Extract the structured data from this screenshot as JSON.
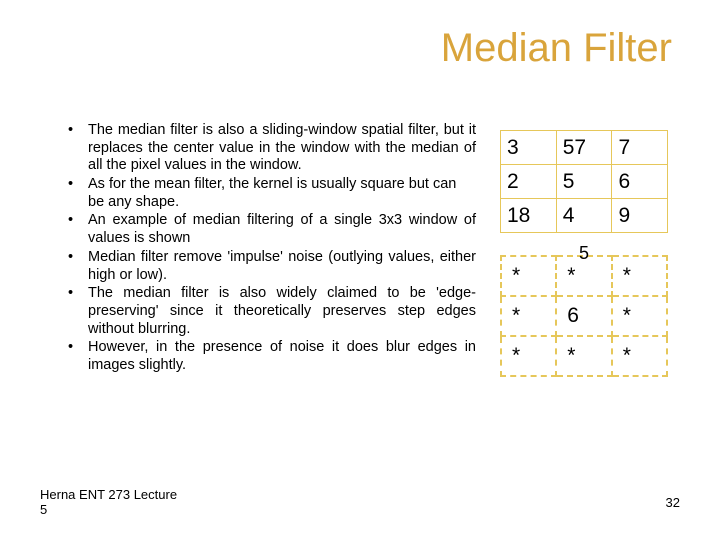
{
  "title": "Median Filter",
  "bullets": {
    "items": [
      "The median filter is also a sliding-window spatial filter, but it replaces the center value in the window with the median of all the pixel values in the window.",
      "As for the mean filter, the kernel is usually square but can be any shape.",
      "An example of median filtering of a single 3x3 window of values is shown",
      "Median filter remove 'impulse' noise (outlying values, either high or low).",
      "The median filter is also widely claimed to be 'edge-preserving' since it theoretically preserves step edges without blurring.",
      "However, in the presence of noise it does blur edges in images slightly."
    ]
  },
  "table_in": {
    "r0": {
      "c0": "3",
      "c1": "57",
      "c2": "7"
    },
    "r1": {
      "c0": "2",
      "c1": "5",
      "c2": "6"
    },
    "r2": {
      "c0": "18",
      "c1": "4",
      "c2": "9"
    }
  },
  "table_out": {
    "note": "5",
    "r0": {
      "c0": "*",
      "c1": "*",
      "c2": "*"
    },
    "r1": {
      "c0": "*",
      "c1": "6",
      "c2": "*"
    },
    "r2": {
      "c0": "*",
      "c1": "*",
      "c2": "*"
    }
  },
  "footer": {
    "left_line1": "Herna ENT 273 Lecture",
    "left_line2": "5",
    "right": "32"
  }
}
